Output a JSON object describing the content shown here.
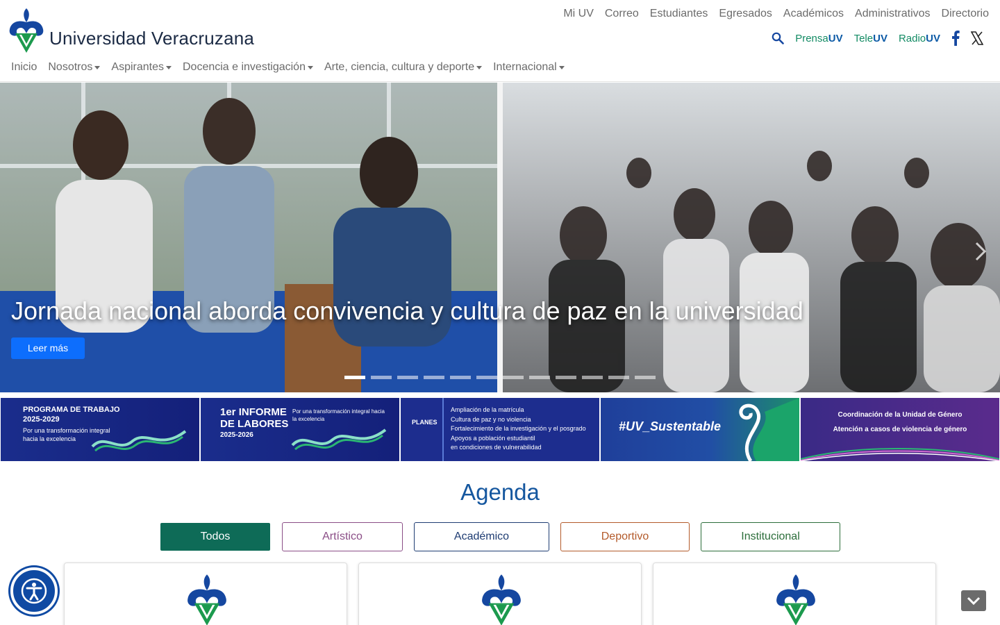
{
  "header": {
    "site_title": "Universidad Veracruzana",
    "top_links": [
      "Mi UV",
      "Correo",
      "Estudiantes",
      "Egresados",
      "Académicos",
      "Administrativos",
      "Directorio"
    ],
    "media": [
      {
        "name": "Prensa",
        "suffix": "UV"
      },
      {
        "name": "Tele",
        "suffix": "UV"
      },
      {
        "name": "Radio",
        "suffix": "UV"
      }
    ],
    "icons": [
      "uv-logo-icon",
      "search-icon",
      "facebook-icon",
      "x-icon"
    ]
  },
  "nav": {
    "items": [
      {
        "label": "Inicio",
        "dropdown": false
      },
      {
        "label": "Nosotros",
        "dropdown": true
      },
      {
        "label": "Aspirantes",
        "dropdown": true
      },
      {
        "label": "Docencia e investigación",
        "dropdown": true
      },
      {
        "label": "Arte, ciencia, cultura y deporte",
        "dropdown": true
      },
      {
        "label": "Internacional",
        "dropdown": true
      }
    ]
  },
  "hero": {
    "caption": "Jornada nacional aborda convivencia y cultura de paz en la universidad",
    "button_label": "Leer más",
    "slide_count": 12,
    "active_slide": 1,
    "icons": [
      "chevron-right-icon"
    ]
  },
  "banners": [
    {
      "line1": "PROGRAMA DE TRABAJO",
      "line2": "2025-2029",
      "line3": "Por una transformación integral",
      "line4": "hacia la excelencia"
    },
    {
      "line1": "1er INFORME",
      "line2": "DE LABORES",
      "line3": "2025-2026",
      "line4": "Por una transformación integral hacia la excelencia"
    },
    {
      "label": "PLANES",
      "items": [
        "Ampliación de la matrícula",
        "Cultura de paz y no violencia",
        "Fortalecimiento de la investigación y el posgrado",
        "Apoyos a población estudiantil",
        "en condiciones de vulnerabilidad"
      ]
    },
    {
      "line1": "#UV_Sustentable"
    },
    {
      "line1": "Coordinación de la Unidad de Género",
      "line2": "Atención a casos de violencia de género"
    }
  ],
  "agenda": {
    "title": "Agenda",
    "filters": [
      "Todos",
      "Artístico",
      "Académico",
      "Deportivo",
      "Institucional"
    ],
    "active_filter": "Todos"
  },
  "colors": {
    "uv_blue": "#0f4aa3",
    "uv_green": "#1c9a4e",
    "title_blue": "#15579f",
    "todos_green": "#0e6b57"
  },
  "widgets": {
    "icons": [
      "accessibility-icon",
      "chevron-down-icon"
    ]
  }
}
